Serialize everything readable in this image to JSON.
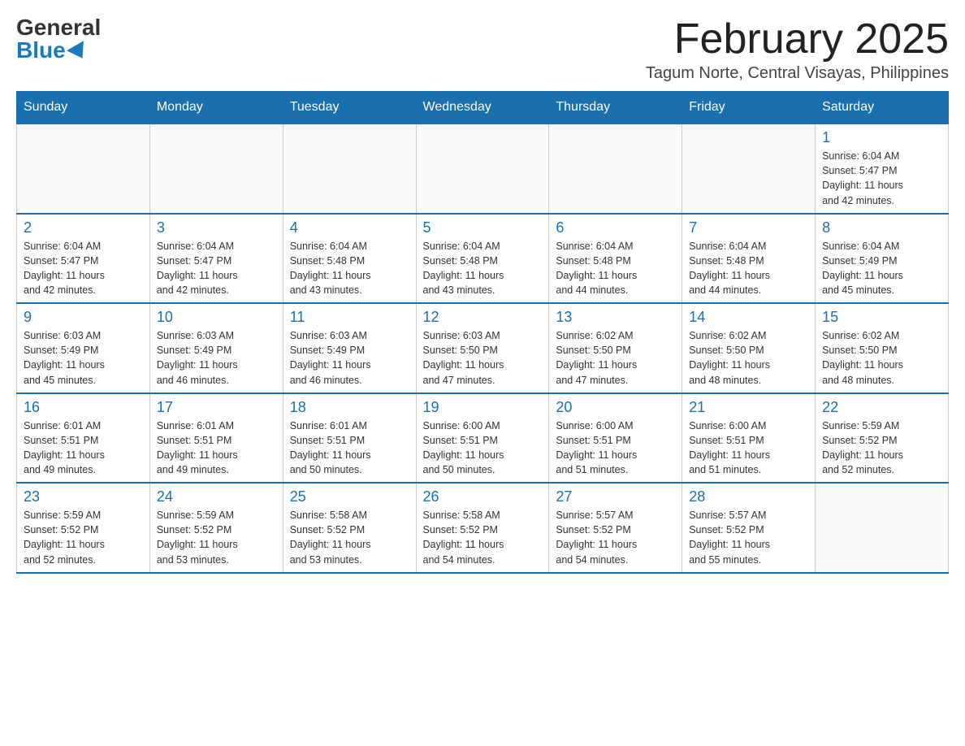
{
  "header": {
    "logo_general": "General",
    "logo_blue": "Blue",
    "month_title": "February 2025",
    "location": "Tagum Norte, Central Visayas, Philippines"
  },
  "days_of_week": [
    "Sunday",
    "Monday",
    "Tuesday",
    "Wednesday",
    "Thursday",
    "Friday",
    "Saturday"
  ],
  "weeks": [
    [
      {
        "day": "",
        "info": ""
      },
      {
        "day": "",
        "info": ""
      },
      {
        "day": "",
        "info": ""
      },
      {
        "day": "",
        "info": ""
      },
      {
        "day": "",
        "info": ""
      },
      {
        "day": "",
        "info": ""
      },
      {
        "day": "1",
        "info": "Sunrise: 6:04 AM\nSunset: 5:47 PM\nDaylight: 11 hours\nand 42 minutes."
      }
    ],
    [
      {
        "day": "2",
        "info": "Sunrise: 6:04 AM\nSunset: 5:47 PM\nDaylight: 11 hours\nand 42 minutes."
      },
      {
        "day": "3",
        "info": "Sunrise: 6:04 AM\nSunset: 5:47 PM\nDaylight: 11 hours\nand 42 minutes."
      },
      {
        "day": "4",
        "info": "Sunrise: 6:04 AM\nSunset: 5:48 PM\nDaylight: 11 hours\nand 43 minutes."
      },
      {
        "day": "5",
        "info": "Sunrise: 6:04 AM\nSunset: 5:48 PM\nDaylight: 11 hours\nand 43 minutes."
      },
      {
        "day": "6",
        "info": "Sunrise: 6:04 AM\nSunset: 5:48 PM\nDaylight: 11 hours\nand 44 minutes."
      },
      {
        "day": "7",
        "info": "Sunrise: 6:04 AM\nSunset: 5:48 PM\nDaylight: 11 hours\nand 44 minutes."
      },
      {
        "day": "8",
        "info": "Sunrise: 6:04 AM\nSunset: 5:49 PM\nDaylight: 11 hours\nand 45 minutes."
      }
    ],
    [
      {
        "day": "9",
        "info": "Sunrise: 6:03 AM\nSunset: 5:49 PM\nDaylight: 11 hours\nand 45 minutes."
      },
      {
        "day": "10",
        "info": "Sunrise: 6:03 AM\nSunset: 5:49 PM\nDaylight: 11 hours\nand 46 minutes."
      },
      {
        "day": "11",
        "info": "Sunrise: 6:03 AM\nSunset: 5:49 PM\nDaylight: 11 hours\nand 46 minutes."
      },
      {
        "day": "12",
        "info": "Sunrise: 6:03 AM\nSunset: 5:50 PM\nDaylight: 11 hours\nand 47 minutes."
      },
      {
        "day": "13",
        "info": "Sunrise: 6:02 AM\nSunset: 5:50 PM\nDaylight: 11 hours\nand 47 minutes."
      },
      {
        "day": "14",
        "info": "Sunrise: 6:02 AM\nSunset: 5:50 PM\nDaylight: 11 hours\nand 48 minutes."
      },
      {
        "day": "15",
        "info": "Sunrise: 6:02 AM\nSunset: 5:50 PM\nDaylight: 11 hours\nand 48 minutes."
      }
    ],
    [
      {
        "day": "16",
        "info": "Sunrise: 6:01 AM\nSunset: 5:51 PM\nDaylight: 11 hours\nand 49 minutes."
      },
      {
        "day": "17",
        "info": "Sunrise: 6:01 AM\nSunset: 5:51 PM\nDaylight: 11 hours\nand 49 minutes."
      },
      {
        "day": "18",
        "info": "Sunrise: 6:01 AM\nSunset: 5:51 PM\nDaylight: 11 hours\nand 50 minutes."
      },
      {
        "day": "19",
        "info": "Sunrise: 6:00 AM\nSunset: 5:51 PM\nDaylight: 11 hours\nand 50 minutes."
      },
      {
        "day": "20",
        "info": "Sunrise: 6:00 AM\nSunset: 5:51 PM\nDaylight: 11 hours\nand 51 minutes."
      },
      {
        "day": "21",
        "info": "Sunrise: 6:00 AM\nSunset: 5:51 PM\nDaylight: 11 hours\nand 51 minutes."
      },
      {
        "day": "22",
        "info": "Sunrise: 5:59 AM\nSunset: 5:52 PM\nDaylight: 11 hours\nand 52 minutes."
      }
    ],
    [
      {
        "day": "23",
        "info": "Sunrise: 5:59 AM\nSunset: 5:52 PM\nDaylight: 11 hours\nand 52 minutes."
      },
      {
        "day": "24",
        "info": "Sunrise: 5:59 AM\nSunset: 5:52 PM\nDaylight: 11 hours\nand 53 minutes."
      },
      {
        "day": "25",
        "info": "Sunrise: 5:58 AM\nSunset: 5:52 PM\nDaylight: 11 hours\nand 53 minutes."
      },
      {
        "day": "26",
        "info": "Sunrise: 5:58 AM\nSunset: 5:52 PM\nDaylight: 11 hours\nand 54 minutes."
      },
      {
        "day": "27",
        "info": "Sunrise: 5:57 AM\nSunset: 5:52 PM\nDaylight: 11 hours\nand 54 minutes."
      },
      {
        "day": "28",
        "info": "Sunrise: 5:57 AM\nSunset: 5:52 PM\nDaylight: 11 hours\nand 55 minutes."
      },
      {
        "day": "",
        "info": ""
      }
    ]
  ]
}
